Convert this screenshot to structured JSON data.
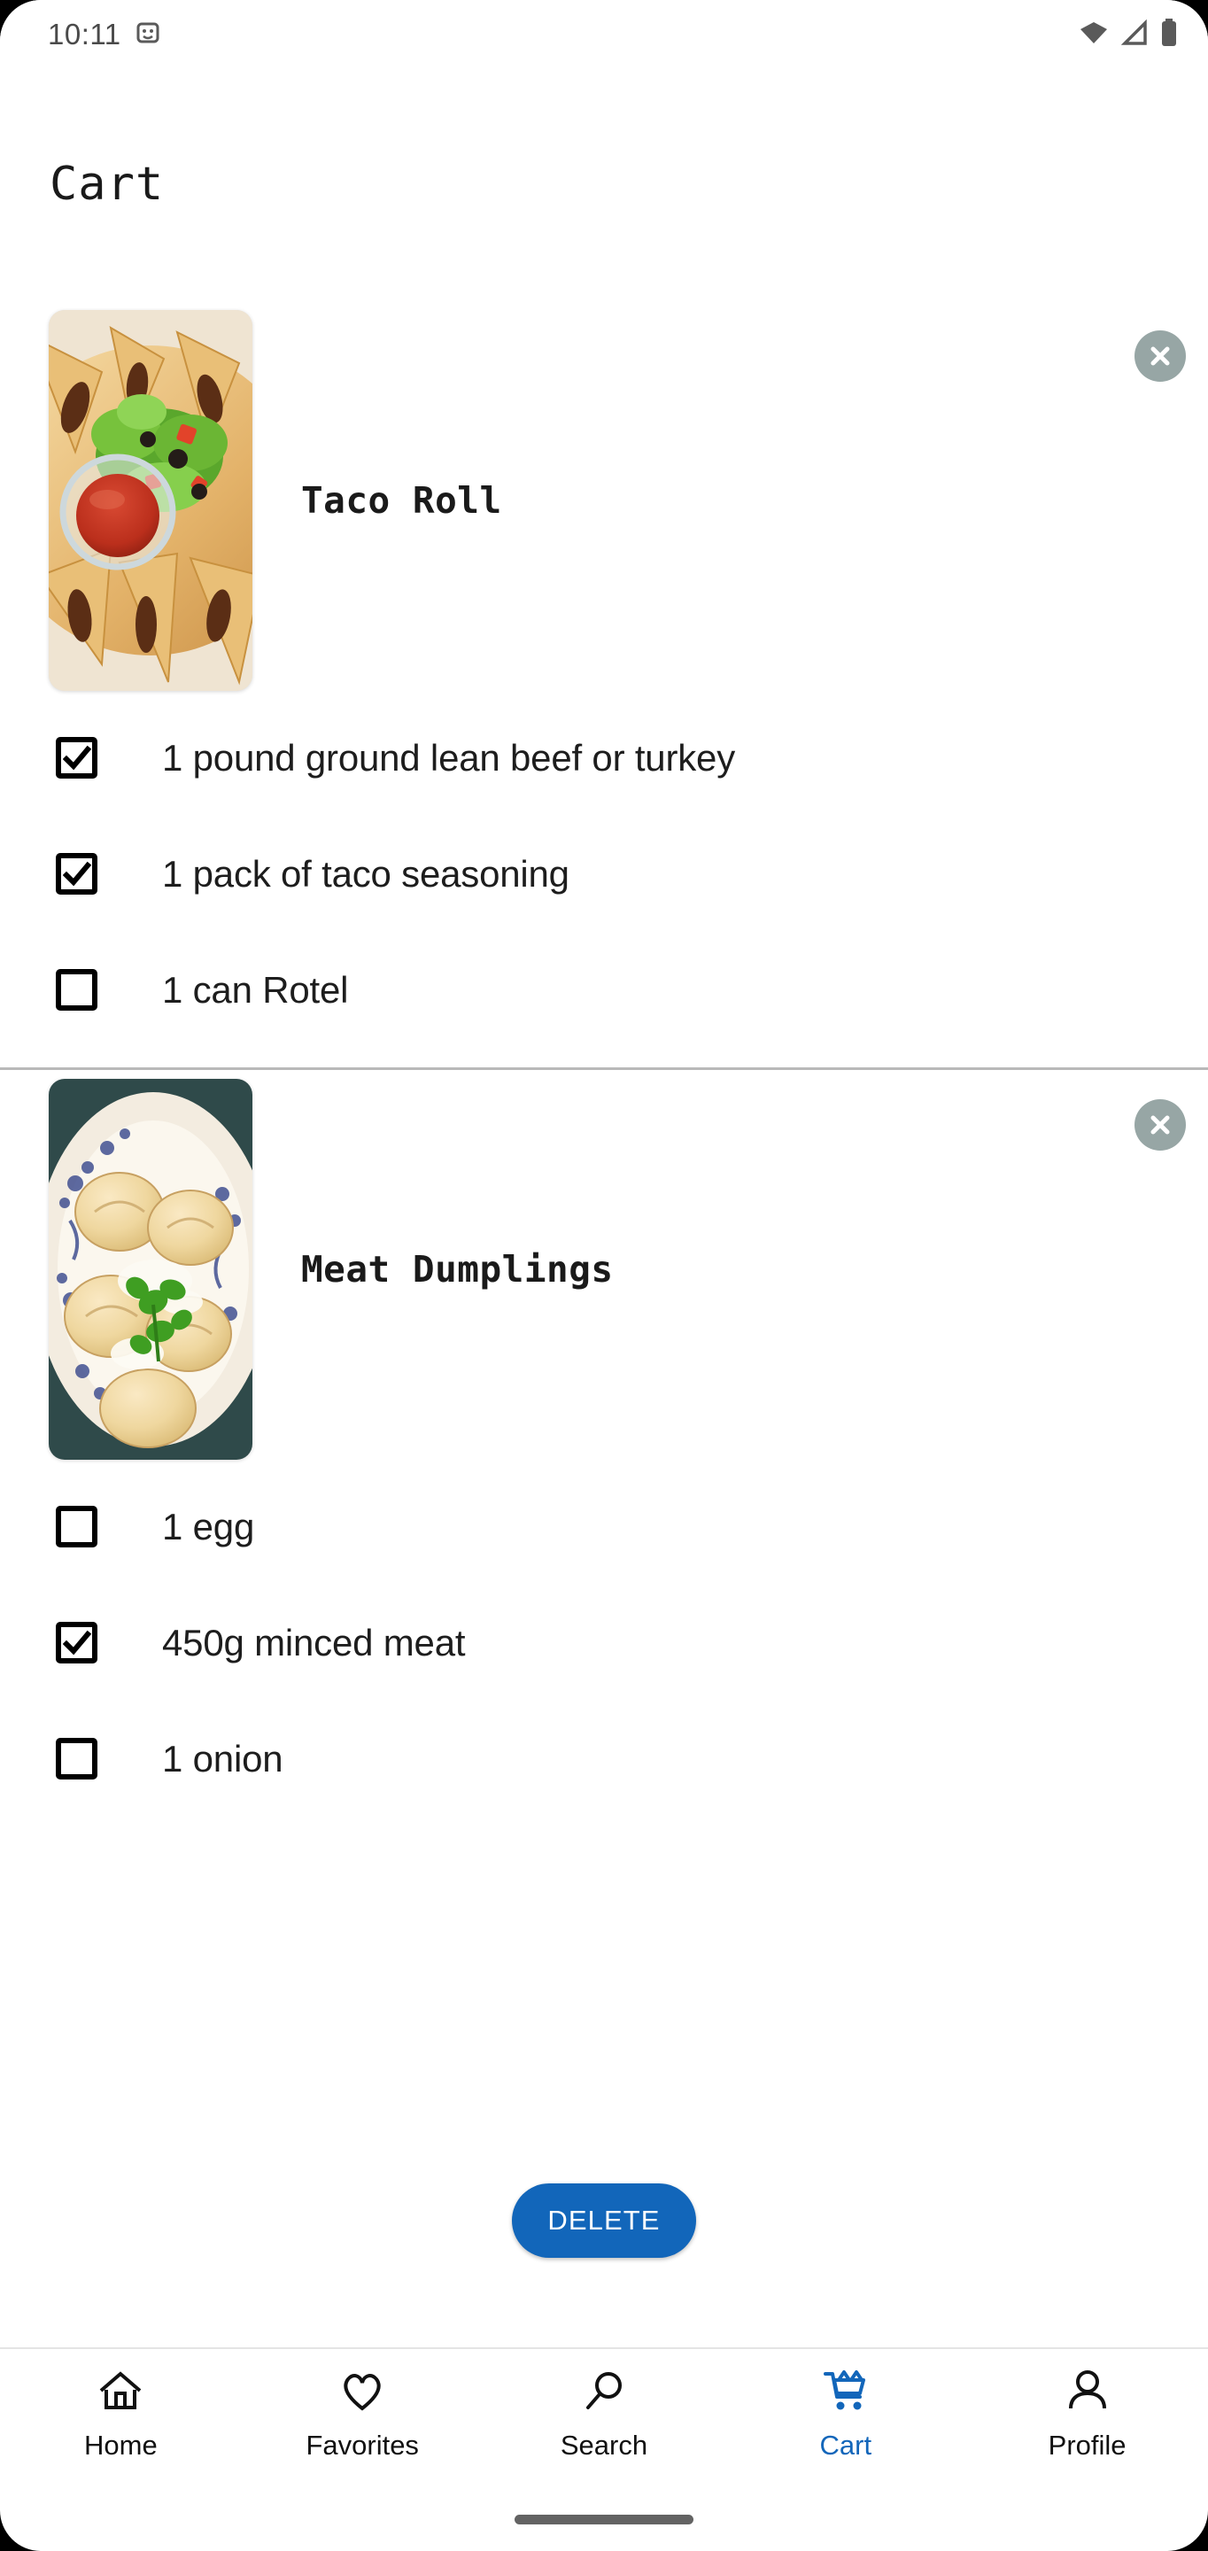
{
  "statusbar": {
    "time": "10:11",
    "icons": [
      "screen-record-icon",
      "wifi-icon",
      "cellular-signal-icon",
      "battery-icon"
    ]
  },
  "header": {
    "title": "Cart"
  },
  "colors": {
    "accent": "#1266ba",
    "close_button_bg": "#97a6a5",
    "divider": "#b9b9b9",
    "text": "#1d1d1d"
  },
  "cart": {
    "items": [
      {
        "name": "Taco Roll",
        "image_alt": "taco-roll-photo",
        "remove_label": "remove",
        "ingredients": [
          {
            "label": "1 pound ground lean beef or turkey",
            "checked": true
          },
          {
            "label": "1 pack of taco seasoning",
            "checked": true
          },
          {
            "label": "1 can Rotel",
            "checked": false
          }
        ]
      },
      {
        "name": "Meat Dumplings",
        "image_alt": "meat-dumplings-photo",
        "remove_label": "remove",
        "ingredients": [
          {
            "label": "1 egg",
            "checked": false
          },
          {
            "label": "450g minced meat",
            "checked": true
          },
          {
            "label": "1 onion",
            "checked": false
          }
        ]
      }
    ]
  },
  "actions": {
    "delete_label": "DELETE"
  },
  "bottom_nav": {
    "active_index": 3,
    "items": [
      {
        "label": "Home",
        "icon": "home-icon"
      },
      {
        "label": "Favorites",
        "icon": "heart-icon"
      },
      {
        "label": "Search",
        "icon": "search-icon"
      },
      {
        "label": "Cart",
        "icon": "cart-icon"
      },
      {
        "label": "Profile",
        "icon": "person-icon"
      }
    ]
  }
}
